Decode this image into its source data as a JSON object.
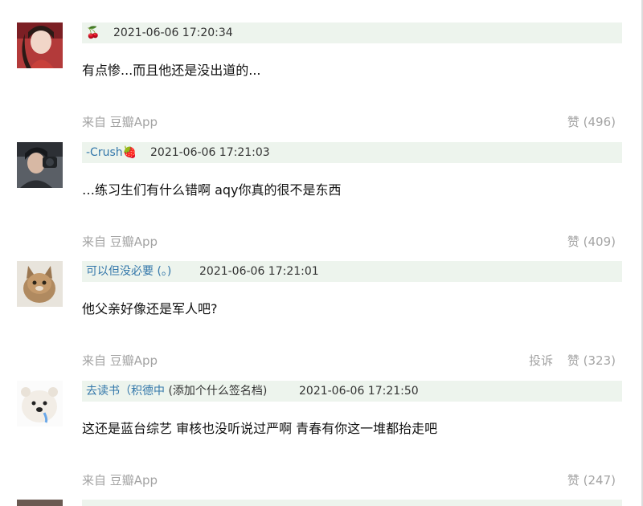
{
  "comments": [
    {
      "author": "🍒",
      "signature": "",
      "timestamp": "2021-06-06 17:20:34",
      "content": "有点惨...而且他还是没出道的...",
      "source": "来自 豆瓣App",
      "report_label": "",
      "like_label": "赞 (496)"
    },
    {
      "author": "-Crush🍓",
      "signature": "",
      "timestamp": "2021-06-06 17:21:03",
      "content": "…练习生们有什么错啊 aqy你真的很不是东西",
      "source": "来自 豆瓣App",
      "report_label": "",
      "like_label": "赞 (409)"
    },
    {
      "author": "可以但没必要 (。)",
      "signature": "",
      "timestamp": "2021-06-06 17:21:01",
      "content": "他父亲好像还是军人吧?",
      "source": "来自 豆瓣App",
      "report_label": "投诉",
      "like_label": "赞 (323)"
    },
    {
      "author": "去读书（积德中",
      "signature": "(添加个什么签名档)",
      "timestamp": "2021-06-06 17:21:50",
      "content": "这还是蓝台综艺 审核也没听说过严啊 青春有你这一堆都抬走吧",
      "source": "来自 豆瓣App",
      "report_label": "",
      "like_label": "赞 (247)"
    }
  ],
  "colors": {
    "meta_bg": "#edf4ed",
    "author_link": "#3377aa",
    "muted": "#a3a3a3"
  }
}
